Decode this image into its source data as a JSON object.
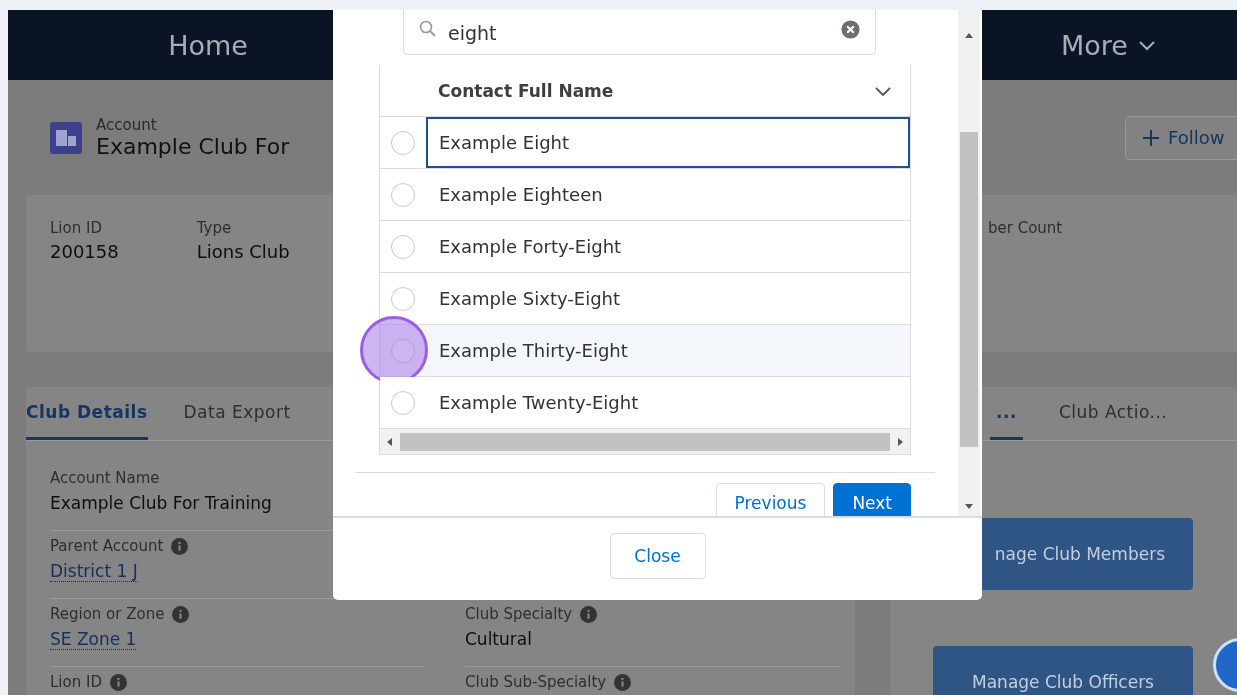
{
  "nav": {
    "home": "Home",
    "more": "More"
  },
  "record": {
    "object_type": "Account",
    "title": "Example Club For",
    "follow_button": "Follow"
  },
  "highlights": [
    {
      "label": "Lion ID",
      "value": "200158"
    },
    {
      "label": "Type",
      "value": "Lions Club"
    }
  ],
  "highlight_right": {
    "label": "ber Count"
  },
  "tabs_left": [
    {
      "label": "Club Details",
      "selected": true
    },
    {
      "label": "Data Export",
      "selected": false
    }
  ],
  "tabs_right": [
    {
      "label": "...",
      "selected": true
    },
    {
      "label": "Club Actio...",
      "selected": false
    }
  ],
  "details": [
    {
      "cells": [
        {
          "label": "Account Name",
          "info": false,
          "value": "Example Club For Training",
          "link": false
        }
      ]
    },
    {
      "cells": [
        {
          "label": "Parent Account",
          "info": true,
          "value": "District 1 J",
          "link": true
        }
      ]
    },
    {
      "cells": [
        {
          "label": "Region or Zone",
          "info": true,
          "value": "SE Zone 1",
          "link": true
        },
        {
          "label": "Club Specialty",
          "info": true,
          "value": "Cultural",
          "link": false
        }
      ]
    },
    {
      "cells": [
        {
          "label": "Lion ID",
          "info": true
        },
        {
          "label": "Club Sub-Specialty",
          "info": true
        }
      ]
    }
  ],
  "actions": [
    "nage Club Members",
    "Manage Club Officers"
  ],
  "modal": {
    "search": {
      "value": "eight"
    },
    "column": "Contact Full Name",
    "rows": [
      {
        "name": "Example Eight",
        "selected": false,
        "focused": true,
        "highlighted": false,
        "clicked": false
      },
      {
        "name": "Example Eighteen",
        "selected": false,
        "focused": false,
        "highlighted": false,
        "clicked": false
      },
      {
        "name": "Example Forty-Eight",
        "selected": false,
        "focused": false,
        "highlighted": false,
        "clicked": false
      },
      {
        "name": "Example Sixty-Eight",
        "selected": false,
        "focused": false,
        "highlighted": false,
        "clicked": false
      },
      {
        "name": "Example Thirty-Eight",
        "selected": false,
        "focused": false,
        "highlighted": true,
        "clicked": true
      },
      {
        "name": "Example Twenty-Eight",
        "selected": false,
        "focused": false,
        "highlighted": false,
        "clicked": false
      }
    ],
    "buttons": [
      {
        "label": "Previous",
        "kind": "neutral"
      },
      {
        "label": "Next",
        "kind": "brand"
      }
    ],
    "close": "Close"
  }
}
